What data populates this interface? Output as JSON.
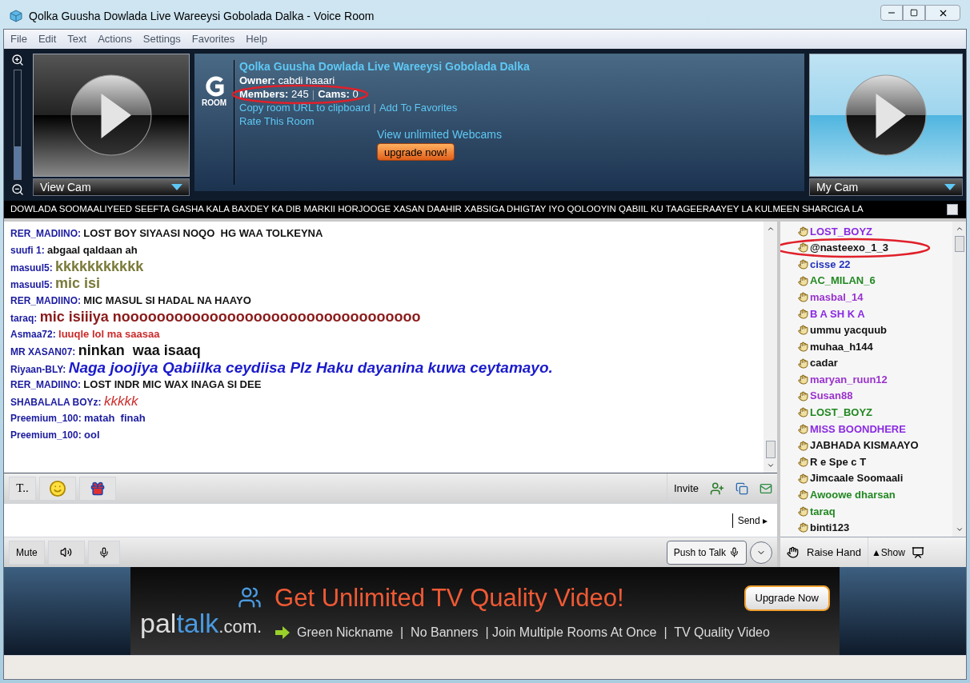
{
  "window": {
    "title": "Qolka Guusha Dowlada Live Wareeysi Gobolada Dalka - Voice Room"
  },
  "menu": [
    "File",
    "Edit",
    "Text",
    "Actions",
    "Settings",
    "Favorites",
    "Help"
  ],
  "zoom": {
    "level": 0.3
  },
  "left_cam": {
    "label": "View Cam"
  },
  "room": {
    "badge": "ROOM",
    "name": "Qolka Guusha Dowlada Live Wareeysi Gobolada Dalka",
    "owner_label": "Owner:",
    "owner": "cabdi haaari",
    "members_label": "Members:",
    "members": "245",
    "stats_separator": "|",
    "cams_label": "Cams:",
    "cams": "0",
    "copy_link": "Copy room URL to clipboard",
    "link_separator": "|",
    "favorites_link": "Add To Favorites",
    "rate_link": "Rate This Room",
    "promo": "View unlimited Webcams",
    "upgrade": "upgrade now!"
  },
  "right_cam": {
    "label": "My Cam"
  },
  "ticker": "DOWLADA SOOMAALIYEED SEEFTA GASHA KALA BAXDEY KA DIB MARKII HORJOOGE XASAN DAAHIR XABSIGA DHIGTAY IYO QOLOOYIN QABIIL KU TAAGEERAAYEY LA KULMEEN SHARCIGA LA",
  "messages": [
    {
      "user": "RER_MADIINO:",
      "text": "LOST BOY SIYAASI NOQO  HG WAA TOLKEYNA",
      "color": "#111111",
      "kind": "normal"
    },
    {
      "user": "suufi 1:",
      "text": "abgaal qaldaan ah",
      "color": "#111111",
      "kind": "normal"
    },
    {
      "user": "masuul5:",
      "text": "kkkkkkkkkkk",
      "color": "#7a7a3a",
      "kind": "large"
    },
    {
      "user": "masuul5:",
      "text": "mic isi",
      "color": "#7a7a3a",
      "kind": "large"
    },
    {
      "user": "RER_MADIINO:",
      "text": "MIC MASUL SI HADAL NA HAAYO",
      "color": "#111111",
      "kind": "normal"
    },
    {
      "user": "taraq:",
      "text": "mic isiiiya noooooooooooooooooooooooooooooooooo",
      "color": "#8b1a1a",
      "kind": "large"
    },
    {
      "user": "Asmaa72:",
      "text": "luuqle lol ma saasaa",
      "color": "#cc2a2a",
      "kind": "normal"
    },
    {
      "user": "MR XASAN07:",
      "text": "ninkan  waa isaaq",
      "color": "#111111",
      "kind": "large"
    },
    {
      "user": "Riyaan-BLY:",
      "text": "Naga joojiya Qabiilka ceydiisa Plz Haku dayanina kuwa ceytamayo.",
      "color": "#1a1acc",
      "kind": "large-italic"
    },
    {
      "user": "RER_MADIINO:",
      "text": "LOST INDR MIC WAX INAGA SI DEE",
      "color": "#111111",
      "kind": "normal"
    },
    {
      "user": "SHABALALA BOYz:",
      "text": "kkkkk",
      "color": "#cc2a2a",
      "kind": "script"
    },
    {
      "user": "Preemium_100:",
      "text": "matah  finah",
      "color": "#1a1aa0",
      "kind": "normal"
    },
    {
      "user": "Preemium_100:",
      "text": "ool",
      "color": "#1a1aa0",
      "kind": "normal"
    }
  ],
  "users": [
    {
      "name": "LOST_BOYZ",
      "color": "#8a2be2"
    },
    {
      "name": "@nasteexo_1_3",
      "color": "#111111"
    },
    {
      "name": "cisse 22",
      "color": "#2233bb"
    },
    {
      "name": "AC_MILAN_6",
      "color": "#228822"
    },
    {
      "name": "masbal_14",
      "color": "#9932cc"
    },
    {
      "name": "B A SH K A",
      "color": "#8a2be2"
    },
    {
      "name": "ummu yacquub",
      "color": "#111111"
    },
    {
      "name": "muhaa_h144",
      "color": "#111111"
    },
    {
      "name": "cadar",
      "color": "#111111"
    },
    {
      "name": "maryan_ruun12",
      "color": "#9932cc"
    },
    {
      "name": "Susan88",
      "color": "#9932cc"
    },
    {
      "name": "LOST_BOYZ",
      "color": "#228822"
    },
    {
      "name": "MISS BOONDHERE",
      "color": "#8a2be2"
    },
    {
      "name": "JABHADA KISMAAYO",
      "color": "#111111"
    },
    {
      "name": "R e Spe c T",
      "color": "#111111"
    },
    {
      "name": "Jimcaale Soomaali",
      "color": "#111111"
    },
    {
      "name": "Awoowe dharsan",
      "color": "#228822"
    },
    {
      "name": "taraq",
      "color": "#228822"
    },
    {
      "name": "binti123",
      "color": "#111111"
    }
  ],
  "toolbar": {
    "font_button": "T..",
    "invite": "Invite"
  },
  "composer": {
    "send": "Send ▸"
  },
  "voice_bar": {
    "mute": "Mute",
    "push_to_talk": "Push to Talk"
  },
  "user_bar": {
    "raise_hand": "Raise Hand",
    "show": "▲Show"
  },
  "ad": {
    "logo_parts": [
      {
        "text": "pal",
        "kind": "plain"
      },
      {
        "text": "talk",
        "kind": "accent"
      },
      {
        "text": ".com.",
        "kind": "plain"
      }
    ],
    "headline": "Get Unlimited TV Quality Video!",
    "features": "Green Nickname  |  No Banners  | Join Multiple Rooms At Once  |  TV Quality Video",
    "button": "Upgrade Now"
  }
}
